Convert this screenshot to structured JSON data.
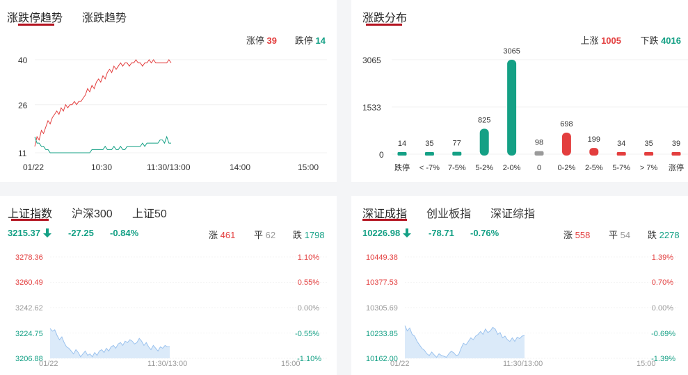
{
  "limit_panel": {
    "tabs": [
      "涨跌停趋势",
      "涨跌趋势"
    ],
    "limit_up_label": "涨停",
    "limit_up_value": "39",
    "limit_down_label": "跌停",
    "limit_down_value": "14",
    "y_ticks": [
      "40",
      "26",
      "11"
    ],
    "x_ticks": [
      "01/22",
      "10:30",
      "11:30/13:00",
      "14:00",
      "15:00"
    ]
  },
  "dist_panel": {
    "tabs": [
      "涨跌分布"
    ],
    "up_label": "上涨",
    "up_value": "1005",
    "down_label": "下跌",
    "down_value": "4016",
    "y_ticks": [
      "3065",
      "1533",
      "0"
    ]
  },
  "sh_panel": {
    "tabs": [
      "上证指数",
      "沪深300",
      "上证50"
    ],
    "price": "3215.37",
    "arrow": "arrow-down-icon",
    "change": "-27.25",
    "change_pct": "-0.84%",
    "up_label": "涨",
    "up_value": "461",
    "flat_label": "平",
    "flat_value": "62",
    "down_label": "跌",
    "down_value": "1798",
    "left_ticks": [
      "3278.36",
      "3260.49",
      "3242.62",
      "3224.75",
      "3206.88"
    ],
    "right_ticks": [
      "1.10%",
      "0.55%",
      "0.00%",
      "-0.55%",
      "-1.10%"
    ],
    "x_ticks": [
      "01/22",
      "11:30/13:00",
      "15:00"
    ]
  },
  "sz_panel": {
    "tabs": [
      "深证成指",
      "创业板指",
      "深证综指"
    ],
    "price": "10226.98",
    "arrow": "arrow-down-icon",
    "change": "-78.71",
    "change_pct": "-0.76%",
    "up_label": "涨",
    "up_value": "558",
    "flat_label": "平",
    "flat_value": "54",
    "down_label": "跌",
    "down_value": "2278",
    "left_ticks": [
      "10449.38",
      "10377.53",
      "10305.69",
      "10233.85",
      "10162.00"
    ],
    "right_ticks": [
      "1.39%",
      "0.70%",
      "0.00%",
      "-0.69%",
      "-1.39%"
    ],
    "x_ticks": [
      "01/22",
      "11:30/13:00",
      "15:00"
    ]
  },
  "colors": {
    "up": "#e33e3e",
    "down": "#14a085",
    "flat": "#9a9a9a",
    "accent": "#b3121f",
    "area": "#dbeaf9",
    "area_line": "#9cc3ee"
  },
  "chart_data": [
    {
      "type": "line",
      "y_ticks": [
        11,
        26,
        40
      ],
      "ylim": [
        11,
        40
      ],
      "x_ticks": [
        "01/22",
        "10:30",
        "11:30/13:00",
        "14:00",
        "15:00"
      ],
      "grid": true,
      "series": [
        {
          "name": "涨停",
          "values": [
            13,
            16,
            15,
            18,
            17,
            19,
            21,
            20,
            22,
            23,
            24,
            23,
            25,
            24,
            26,
            25,
            26,
            26,
            27,
            26,
            27,
            27,
            28,
            29,
            31,
            30,
            32,
            31,
            33,
            34,
            33,
            35,
            34,
            36,
            37,
            36,
            38,
            37,
            38,
            39,
            38,
            39,
            39,
            38,
            39,
            39,
            40,
            39,
            39,
            38,
            39,
            39,
            40,
            39,
            40,
            39,
            39,
            39,
            39,
            39,
            39,
            40,
            39
          ]
        },
        {
          "name": "跌停",
          "values": [
            16,
            14,
            14,
            13,
            13,
            12,
            12,
            11,
            11,
            11,
            11,
            11,
            11,
            11,
            11,
            11,
            11,
            11,
            11,
            11,
            11,
            11,
            11,
            11,
            11,
            11,
            12,
            12,
            12,
            12,
            12,
            12,
            13,
            12,
            12,
            12,
            13,
            12,
            12,
            13,
            12,
            12,
            13,
            13,
            13,
            13,
            13,
            13,
            13,
            14,
            13,
            14,
            14,
            14,
            14,
            14,
            14,
            15,
            15,
            14,
            16,
            14,
            14
          ]
        }
      ]
    },
    {
      "type": "bar",
      "categories": [
        "跌停",
        "< -7%",
        "7-5%",
        "5-2%",
        "2-0%",
        "0",
        "0-2%",
        "2-5%",
        "5-7%",
        "> 7%",
        "涨停"
      ],
      "values": [
        14,
        35,
        77,
        825,
        3065,
        98,
        698,
        199,
        34,
        35,
        39
      ],
      "y_ticks": [
        0,
        1533,
        3065
      ],
      "ylim": [
        0,
        3065
      ],
      "grid": true
    },
    {
      "type": "area",
      "name": "上证指数",
      "ylim": [
        3206.88,
        3278.36
      ],
      "baseline": 3242.62,
      "values": [
        3228,
        3226,
        3227,
        3223,
        3220,
        3222,
        3218,
        3215,
        3214,
        3212,
        3210,
        3213,
        3211,
        3208,
        3210,
        3212,
        3209,
        3210,
        3208,
        3211,
        3209,
        3212,
        3213,
        3211,
        3214,
        3212,
        3215,
        3216,
        3214,
        3217,
        3218,
        3216,
        3219,
        3218,
        3220,
        3219,
        3217,
        3218,
        3221,
        3219,
        3216,
        3218,
        3215,
        3213,
        3216,
        3214,
        3212,
        3215,
        3214,
        3216,
        3215,
        3215
      ]
    },
    {
      "type": "area",
      "name": "深证成指",
      "ylim": [
        10162.0,
        10449.38
      ],
      "baseline": 10305.69,
      "values": [
        10255,
        10240,
        10248,
        10230,
        10225,
        10210,
        10200,
        10190,
        10185,
        10175,
        10170,
        10180,
        10172,
        10165,
        10175,
        10170,
        10168,
        10165,
        10175,
        10182,
        10178,
        10170,
        10172,
        10190,
        10205,
        10200,
        10210,
        10220,
        10215,
        10225,
        10230,
        10238,
        10230,
        10245,
        10235,
        10240,
        10250,
        10245,
        10230,
        10235,
        10220,
        10225,
        10215,
        10210,
        10220,
        10210,
        10222,
        10218,
        10225,
        10227
      ]
    }
  ]
}
